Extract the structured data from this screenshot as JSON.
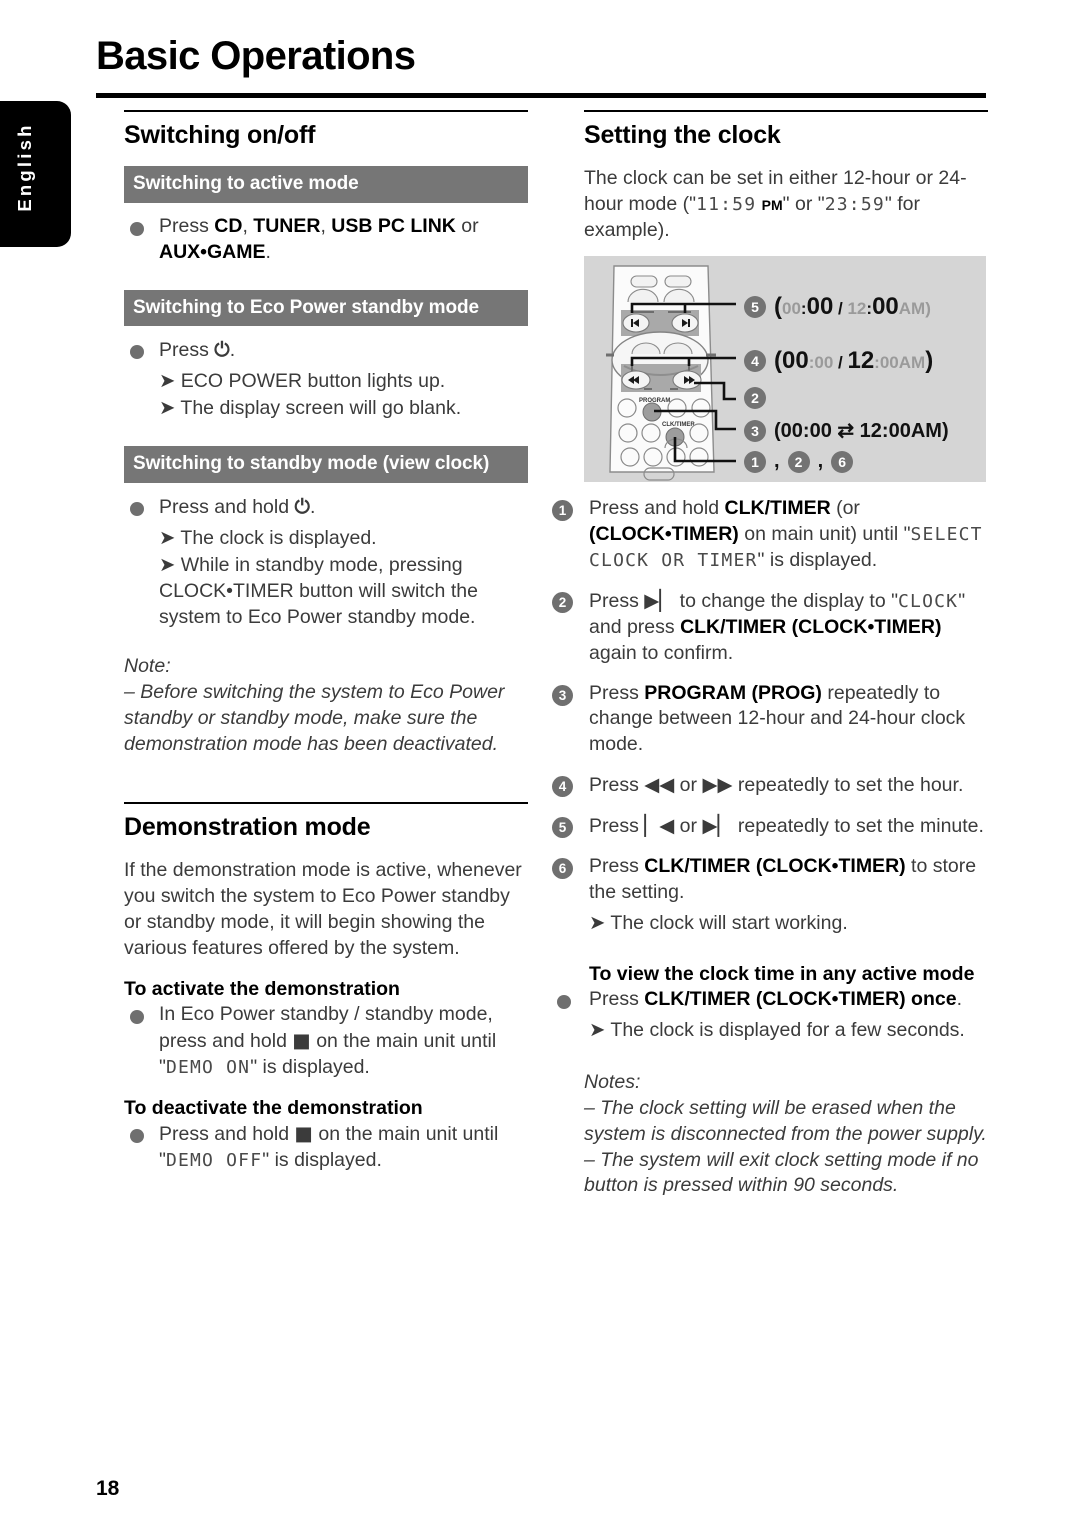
{
  "page": {
    "title": "Basic Operations",
    "language_tab": "English",
    "page_number": "18"
  },
  "left_column": {
    "section1": {
      "heading": "Switching on/off",
      "blocks": [
        {
          "bar": "Switching to active mode",
          "bullet_pre": "Press ",
          "bullet_bold1": "CD",
          "sep1": ", ",
          "bullet_bold2": "TUNER",
          "sep2": ", ",
          "bullet_bold3": "USB PC LINK",
          "sep3": " or ",
          "bullet_bold4": "AUX•GAME",
          "bullet_end": "."
        },
        {
          "bar": "Switching to Eco Power standby mode",
          "bullet": "Press",
          "power_icon": "power-icon",
          "bullet_end": ".",
          "arrows": [
            "ECO POWER button lights up.",
            "The display screen will go blank."
          ]
        },
        {
          "bar": "Switching to standby mode (view clock)",
          "bullet": "Press and hold",
          "power_icon": "power-icon",
          "bullet_end": ".",
          "arrows": [
            "The clock is displayed.",
            "While in standby mode, pressing CLOCK•TIMER button will switch the system to Eco Power standby mode."
          ]
        }
      ],
      "note_label": "Note:",
      "note_text": "–  Before switching the system to Eco Power standby or standby mode, make sure the demonstration mode has been deactivated."
    },
    "section2": {
      "heading": "Demonstration mode",
      "intro": "If the demonstration mode is active, whenever you switch the system to Eco Power standby or standby mode, it will begin showing the various features offered by the system.",
      "activate": {
        "subhead": "To activate the demonstration",
        "text_pre": "In Eco Power standby / standby mode, press and hold ",
        "stop_icon": "stop-square-icon",
        "text_mid": " on the main unit until \"",
        "lcd": "DEMO ON",
        "text_end": "\" is displayed."
      },
      "deactivate": {
        "subhead": "To deactivate the demonstration",
        "text_pre": "Press and hold ",
        "stop_icon": "stop-square-icon",
        "text_mid": " on the main unit until \"",
        "lcd": "DEMO OFF",
        "text_end": "\" is displayed."
      }
    }
  },
  "right_column": {
    "heading": "Setting the clock",
    "intro_pre": "The clock can be set in either 12-hour or 24-hour mode (\"",
    "intro_lcd1": "11:59",
    "intro_pm": "PM",
    "intro_mid": "\" or \"",
    "intro_lcd2": "23:59",
    "intro_end": "\" for example).",
    "diagram": {
      "name": "remote-control-illustration",
      "button_labels": {
        "program": "PROGRAM",
        "clk_timer": "CLK/TIMER"
      },
      "callouts": [
        {
          "num": "5",
          "parts": [
            {
              "t": "(",
              "style": "black-big"
            },
            {
              "t": "00",
              "style": "dim-sm"
            },
            {
              "t": ":",
              "style": "black-sm"
            },
            {
              "t": "00",
              "style": "black-big"
            },
            {
              "t": " / ",
              "style": "black-sm"
            },
            {
              "t": "12",
              "style": "dim-sm"
            },
            {
              "t": ":",
              "style": "black-sm"
            },
            {
              "t": "00",
              "style": "black-big"
            },
            {
              "t": "AM",
              "style": "dim-sm"
            },
            {
              "t": ")",
              "style": "dim-sm"
            }
          ],
          "text": "(00:00 / 12:00AM)"
        },
        {
          "num": "4",
          "parts": [
            {
              "t": "(",
              "style": "black-big"
            },
            {
              "t": "00",
              "style": "black-big"
            },
            {
              "t": ":",
              "style": "dim-sm"
            },
            {
              "t": "00",
              "style": "dim-sm"
            },
            {
              "t": " / ",
              "style": "black-sm"
            },
            {
              "t": "12",
              "style": "black-big"
            },
            {
              "t": ":",
              "style": "dim-sm"
            },
            {
              "t": "00",
              "style": "dim-sm"
            },
            {
              "t": "AM",
              "style": "dim-sm"
            },
            {
              "t": ")",
              "style": "black-big"
            }
          ],
          "text": "(00:00 / 12:00AM)"
        },
        {
          "num": "2",
          "text": ""
        },
        {
          "num": "3",
          "text": "(00:00 ⇄ 12:00AM)"
        },
        {
          "num_group": [
            "1",
            "2",
            "6"
          ],
          "text": ""
        }
      ]
    },
    "steps": [
      {
        "num": "1",
        "pre": "Press and hold ",
        "bold1": "CLK/TIMER",
        "mid1": " (or ",
        "bold2": "(CLOCK•TIMER)",
        "mid2": " on main unit) until \"",
        "lcd": "SELECT CLOCK OR TIMER",
        "end": "\" is displayed."
      },
      {
        "num": "2",
        "pre": "Press ",
        "icon": "next-track-icon",
        "mid1": " to change the display to \"",
        "lcd": "CLOCK",
        "mid2": "\" and press ",
        "bold1": "CLK/TIMER",
        "mid3": " ",
        "bold2": "(CLOCK•TIMER)",
        "end": " again to confirm."
      },
      {
        "num": "3",
        "pre": "Press ",
        "bold1": "PROGRAM (PROG)",
        "end": " repeatedly to change between 12-hour and 24-hour clock mode."
      },
      {
        "num": "4",
        "pre": "Press ",
        "icon1": "rewind-icon",
        "mid": " or ",
        "icon2": "fast-forward-icon",
        "end": " repeatedly to set the hour."
      },
      {
        "num": "5",
        "pre": "Press ",
        "icon1": "previous-track-icon",
        "mid": " or ",
        "icon2": "next-track-icon",
        "end": " repeatedly to set the minute."
      },
      {
        "num": "6",
        "pre": "Press ",
        "bold1": "CLK/TIMER (CLOCK•TIMER)",
        "end": " to store the setting.",
        "arrow": "The clock will start working."
      }
    ],
    "view_clock": {
      "subhead": "To view the clock time in any active mode",
      "bullet_pre": "Press ",
      "bullet_bold": "CLK/TIMER (CLOCK•TIMER) once",
      "bullet_end": ".",
      "arrow": "The clock is displayed for a few seconds."
    },
    "notes_label": "Notes:",
    "notes": [
      "–  The clock setting will be erased when the system is disconnected from the power supply.",
      "–  The system will exit clock setting mode if no button is pressed within 90 seconds."
    ]
  },
  "colors": {
    "bar_gray": "#767676",
    "bullet_gray": "#6f6f6f",
    "diagram_bg": "#d5d5d5",
    "text": "#3b3b3b",
    "black": "#000000"
  }
}
